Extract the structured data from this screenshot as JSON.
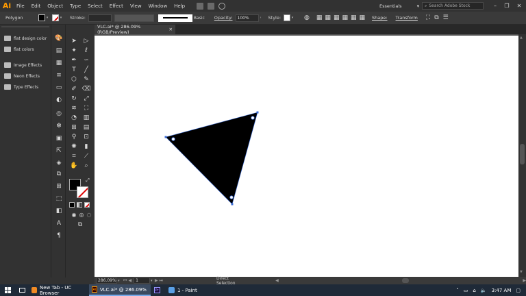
{
  "menubar": {
    "logo": "Ai",
    "items": [
      "File",
      "Edit",
      "Object",
      "Type",
      "Select",
      "Effect",
      "View",
      "Window",
      "Help"
    ],
    "workspace": "Essentials",
    "search_placeholder": "Search Adobe Stock"
  },
  "controlbar": {
    "selection_label": "Polygon",
    "stroke_label": "Stroke:",
    "stroke_profile": "Basic",
    "opacity_label": "Opacity:",
    "opacity_value": "100%",
    "style_label": "Style:",
    "shape_button": "Shape:",
    "transform_button": "Transform"
  },
  "left_panel": {
    "items": [
      "flat design color",
      "flat colors",
      "Image Effects",
      "Neon Effects",
      "Type Effects"
    ]
  },
  "document": {
    "tab_title": "VLC.ai* @ 286.09% (RGB/Preview)",
    "triangle_fill": "#000000",
    "anchor_color": "#3a6bd6"
  },
  "status": {
    "zoom": "286.09%",
    "artboard": "1",
    "tool": "Direct Selection"
  },
  "taskbar": {
    "items": [
      {
        "label": "New Tab - UC Browser"
      },
      {
        "label": "VLC.ai* @ 286.09% (R..."
      },
      {
        "label": ""
      },
      {
        "label": "1 - Paint"
      }
    ],
    "time": "3:47 AM"
  }
}
